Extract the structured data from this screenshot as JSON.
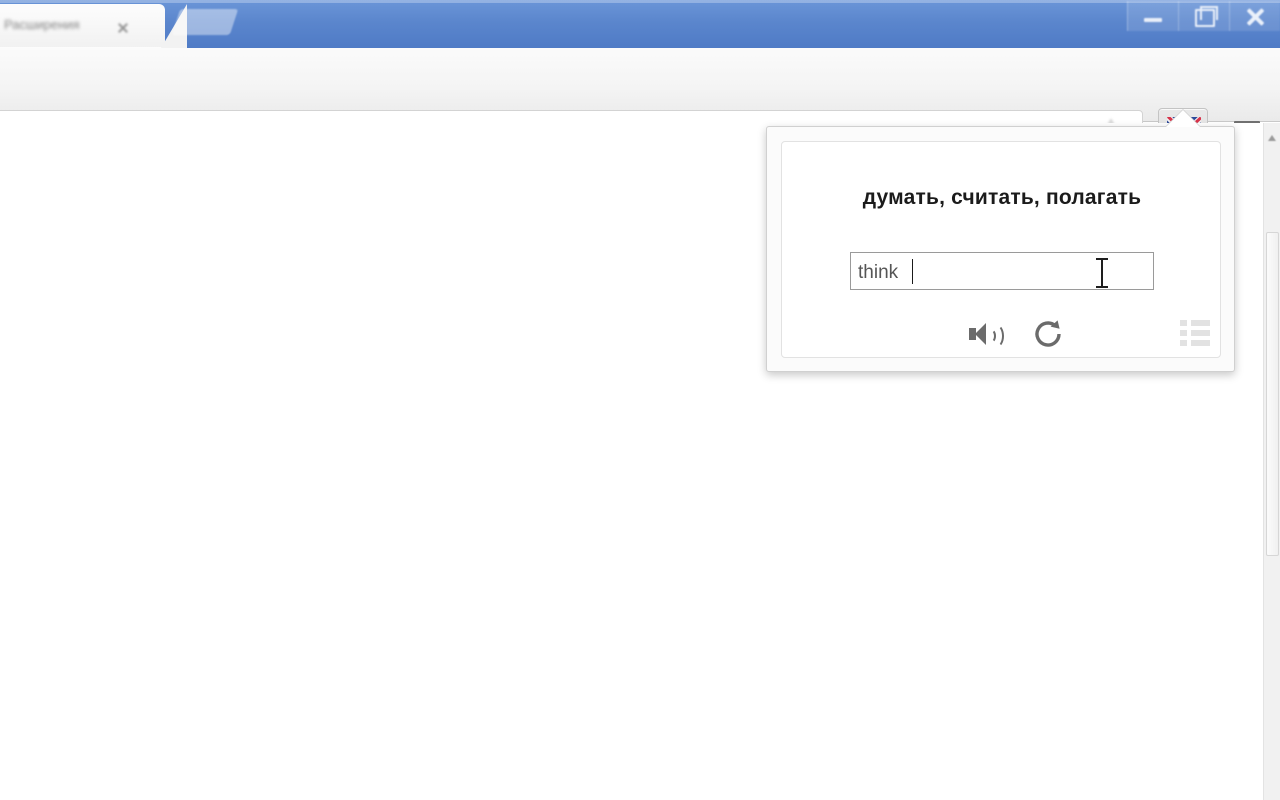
{
  "window": {
    "controls": [
      {
        "name": "minimize",
        "label": "—"
      },
      {
        "name": "restore",
        "label": "❐"
      },
      {
        "name": "close",
        "label": "✕"
      }
    ]
  },
  "tabstrip": {
    "tab_title": "Расширения",
    "close_label": "×",
    "new_tab_label": "+"
  },
  "toolbar": {
    "omnibox_value": "",
    "omnibox_placeholder": "",
    "bookmark_icon": "star-icon",
    "extension_icon": "union-jack-flag-icon",
    "menu_icon": "hamburger-menu-icon"
  },
  "page": {
    "ghost_lines": [
      "",
      "",
      "",
      "",
      ""
    ]
  },
  "scrollbar": {
    "up_arrow": "scroll-up-arrow",
    "thumb_position_pct": 16
  },
  "popup": {
    "heading": "думать, считать, полагать",
    "input": {
      "value": "think",
      "placeholder": ""
    },
    "actions": [
      {
        "name": "speak-button",
        "icon": "speaker-icon",
        "label": ""
      },
      {
        "name": "refresh-button",
        "icon": "refresh-icon",
        "label": ""
      },
      {
        "name": "history-list-button",
        "icon": "list-icon",
        "label": ""
      }
    ]
  },
  "colors": {
    "titlebar": "#5b86cd",
    "toolbar": "#f4f4f4",
    "popup_bg": "#ffffff",
    "heading_text": "#1b1b1b",
    "input_border": "#9a9a9a",
    "icon_gray": "#6b6b6b",
    "list_icon_gray": "#e2e2e2",
    "flag_blue": "#2c4a9a",
    "flag_red": "#d8334a"
  }
}
